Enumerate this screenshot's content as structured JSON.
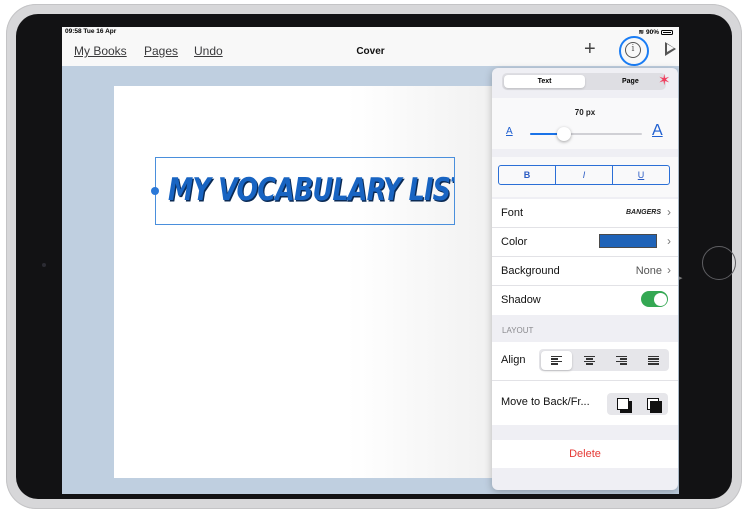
{
  "status": {
    "time": "09:58  Tue 16 Apr",
    "battery": "90%"
  },
  "nav": {
    "my_books": "My Books",
    "pages": "Pages",
    "undo": "Undo",
    "title": "Cover",
    "plus": "+",
    "info": "i"
  },
  "canvas": {
    "text": "MY VOCABULARY LIST"
  },
  "panel": {
    "tab_text": "Text",
    "tab_page": "Page",
    "size_label": "70 px",
    "size_slider_fraction": 0.3,
    "a_small": "A",
    "a_large": "A",
    "bold": "B",
    "italic": "I",
    "underline": "U",
    "font_label": "Font",
    "font_value": "BANGERS",
    "color_label": "Color",
    "color_value": "#1f63b8",
    "background_label": "Background",
    "background_value": "None",
    "shadow_label": "Shadow",
    "shadow_on": true,
    "layout_header": "LAYOUT",
    "align_label": "Align",
    "move_label": "Move to Back/Fr...",
    "delete_label": "Delete",
    "chevron": "›"
  }
}
